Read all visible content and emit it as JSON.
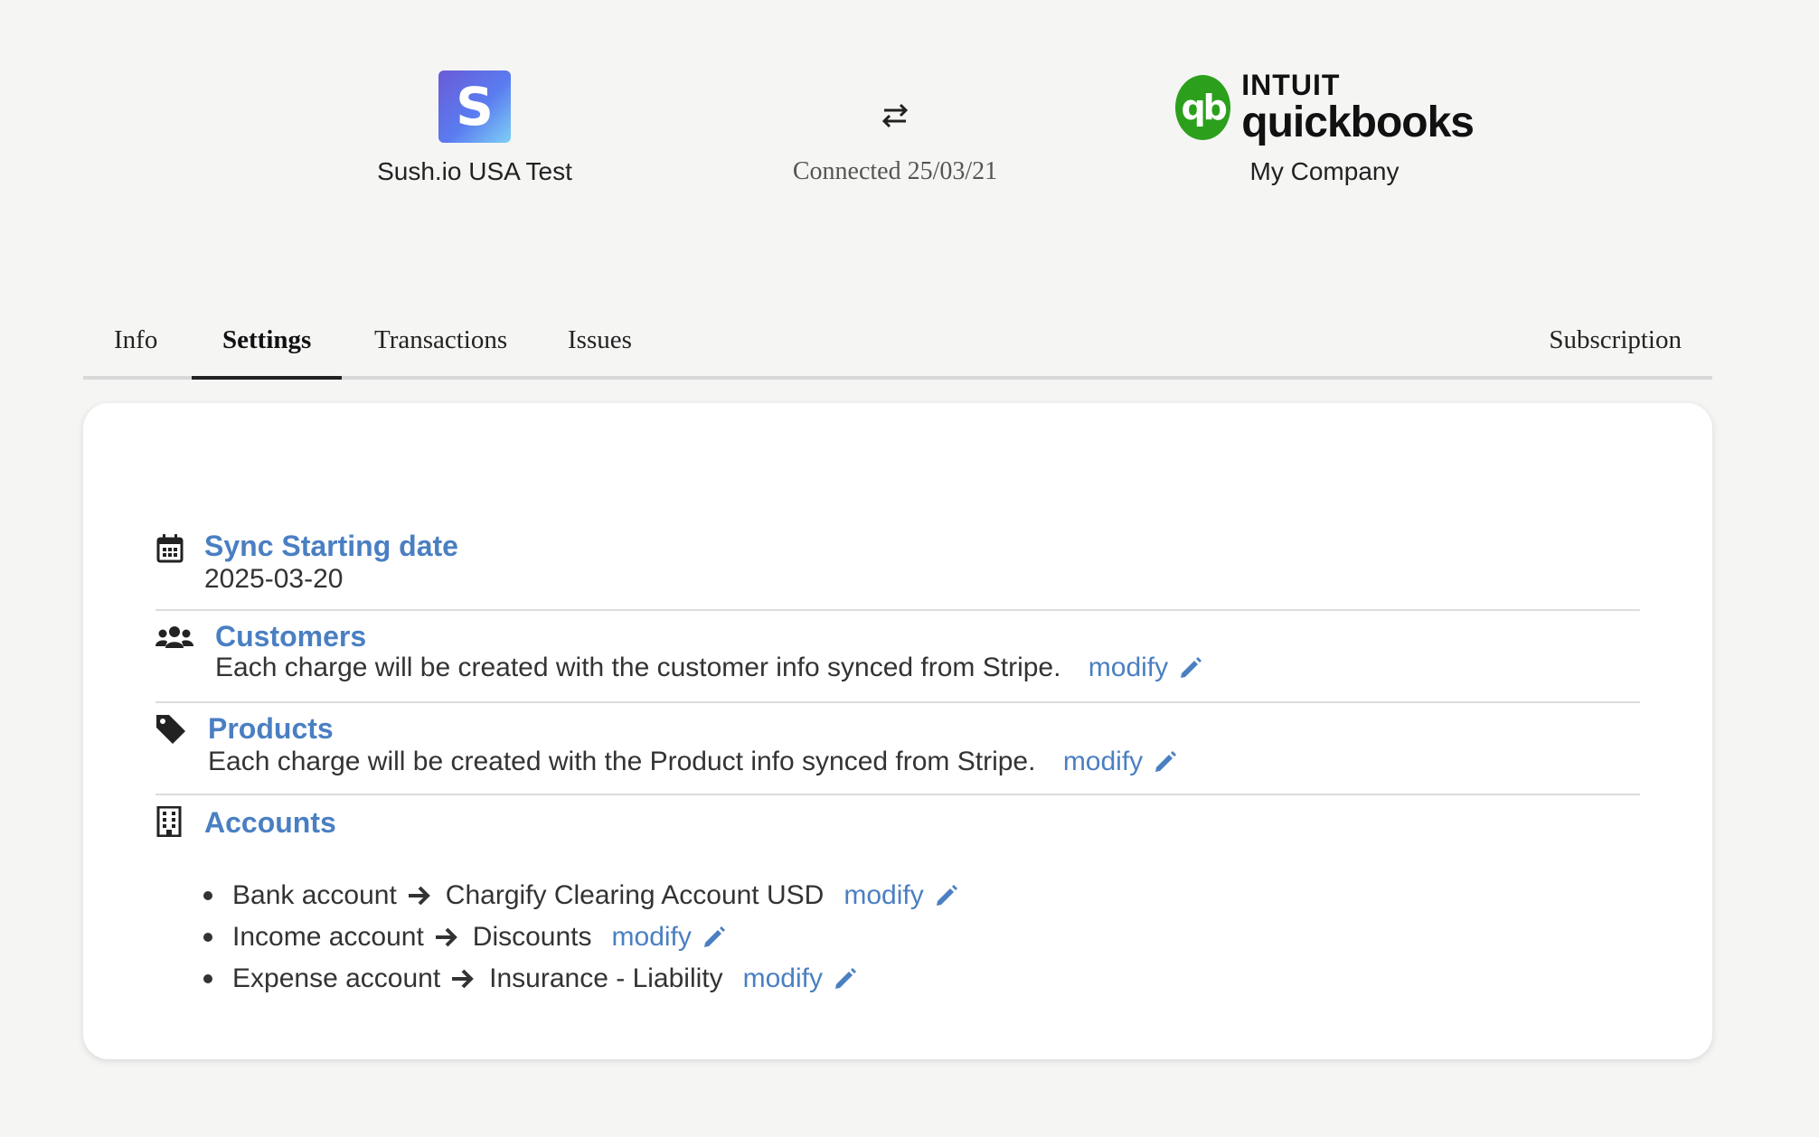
{
  "header": {
    "source": {
      "logo_letter": "S",
      "name": "Sush.io USA Test"
    },
    "connection": {
      "icon": "swap-arrows-icon",
      "status": "Connected 25/03/21"
    },
    "target": {
      "logo_mark": "qb",
      "brand_top": "INTUIT",
      "brand_main": "quickbooks",
      "company": "My Company"
    }
  },
  "tabs": [
    {
      "label": "Info"
    },
    {
      "label": "Settings",
      "active": true
    },
    {
      "label": "Transactions"
    },
    {
      "label": "Issues"
    },
    {
      "label": "Subscription"
    }
  ],
  "settings": {
    "sync": {
      "icon": "calendar-icon",
      "title": "Sync Starting date",
      "value": "2025-03-20"
    },
    "customers": {
      "icon": "users-icon",
      "title": "Customers",
      "description": "Each charge will be created with the customer info synced from Stripe.",
      "action": "modify"
    },
    "products": {
      "icon": "tag-icon",
      "title": "Products",
      "description": "Each charge will be created with the Product info synced from Stripe.",
      "action": "modify"
    },
    "accounts": {
      "icon": "building-icon",
      "title": "Accounts",
      "items": [
        {
          "label": "Bank account",
          "value": "Chargify Clearing Account USD",
          "action": "modify"
        },
        {
          "label": "Income account",
          "value": "Discounts",
          "action": "modify"
        },
        {
          "label": "Expense account",
          "value": "Insurance - Liability",
          "action": "modify"
        }
      ]
    }
  },
  "colors": {
    "accent": "#4a7fc2",
    "qb_green": "#2ca01c",
    "background": "#f5f5f4"
  }
}
